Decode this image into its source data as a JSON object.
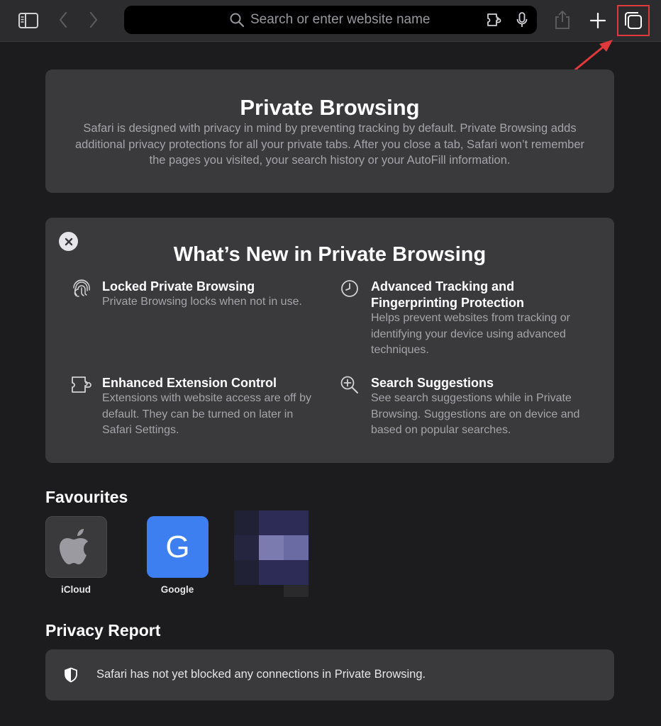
{
  "toolbar": {
    "search_placeholder": "Search or enter website name",
    "icons": [
      "sidebar-icon",
      "back-chevron-icon",
      "forward-chevron-icon",
      "search-icon",
      "extension-icon",
      "microphone-icon",
      "share-icon",
      "plus-icon",
      "tabs-overview-icon"
    ]
  },
  "private_browsing": {
    "title": "Private Browsing",
    "description": "Safari is designed with privacy in mind by preventing tracking by default. Private Browsing adds additional privacy protections for all your private tabs. After you close a tab, Safari won’t remember the pages you visited, your search history or your AutoFill information."
  },
  "whats_new": {
    "title": "What’s New in Private Browsing",
    "features": [
      {
        "icon": "fingerprint-icon",
        "title": "Locked Private Browsing",
        "description": "Private Browsing locks when not in use."
      },
      {
        "icon": "clock-icon",
        "title": "Advanced Tracking and Fingerprinting Protection",
        "description": "Helps prevent websites from tracking or identifying your device using advanced techniques."
      },
      {
        "icon": "extension-icon",
        "title": "Enhanced Extension Control",
        "description": "Extensions with website access are off by default. They can be turned on later in Safari Settings."
      },
      {
        "icon": "search-plus-icon",
        "title": "Search Suggestions",
        "description": "See search suggestions while in Private Browsing. Suggestions are on device and based on popular searches."
      }
    ]
  },
  "favourites": {
    "title": "Favourites",
    "items": [
      {
        "label": "iCloud",
        "icon": "apple-logo-icon"
      },
      {
        "label": "Google",
        "glyph": "G",
        "color": "#3d7ff0"
      },
      {
        "label": "",
        "icon": "pixelated-thumbnail"
      }
    ]
  },
  "privacy_report": {
    "title": "Privacy Report",
    "text": "Safari has not yet blocked any connections in Private Browsing."
  },
  "colors": {
    "background": "#1c1c1e",
    "card": "#3a3a3c",
    "highlight": "#e0393b",
    "google_blue": "#3d7ff0"
  }
}
